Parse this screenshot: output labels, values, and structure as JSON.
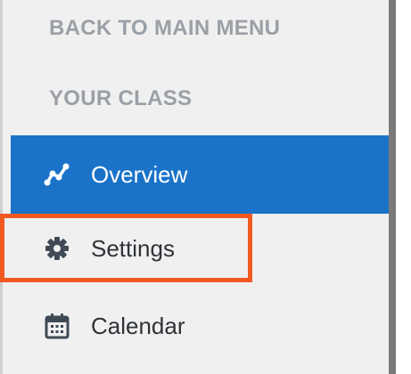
{
  "sidebar": {
    "back_link": "BACK TO MAIN MENU",
    "section_heading": "YOUR CLASS",
    "items": [
      {
        "label": "Overview",
        "icon": "activity-graph-icon",
        "active": true
      },
      {
        "label": "Settings",
        "icon": "gear-icon",
        "active": false
      },
      {
        "label": "Calendar",
        "icon": "calendar-icon",
        "active": false
      }
    ]
  },
  "colors": {
    "active_bg": "#1a73c8",
    "highlight": "#f05a22",
    "muted_text": "#9aa0a6",
    "sidebar_bg": "#f0f0f0"
  }
}
